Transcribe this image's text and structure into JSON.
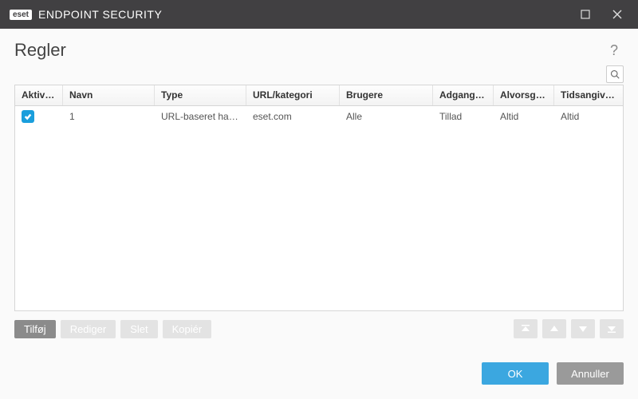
{
  "titlebar": {
    "brand_tag": "eset",
    "brand_text": "ENDPOINT SECURITY"
  },
  "page": {
    "title": "Regler"
  },
  "table": {
    "headers": {
      "enabled": "Aktiver...",
      "name": "Navn",
      "type": "Type",
      "url": "URL/kategori",
      "users": "Brugere",
      "access": "Adgangsre...",
      "severity": "Alvorsgrad",
      "time": "Tidsangive..."
    },
    "rows": [
      {
        "enabled": true,
        "name": "1",
        "type": "URL-baseret handli...",
        "url": "eset.com",
        "users": "Alle",
        "access": "Tillad",
        "severity": "Altid",
        "time": "Altid"
      }
    ]
  },
  "actions": {
    "add": "Tilføj",
    "edit": "Rediger",
    "delete": "Slet",
    "copy": "Kopiér"
  },
  "footer": {
    "ok": "OK",
    "cancel": "Annuller"
  }
}
